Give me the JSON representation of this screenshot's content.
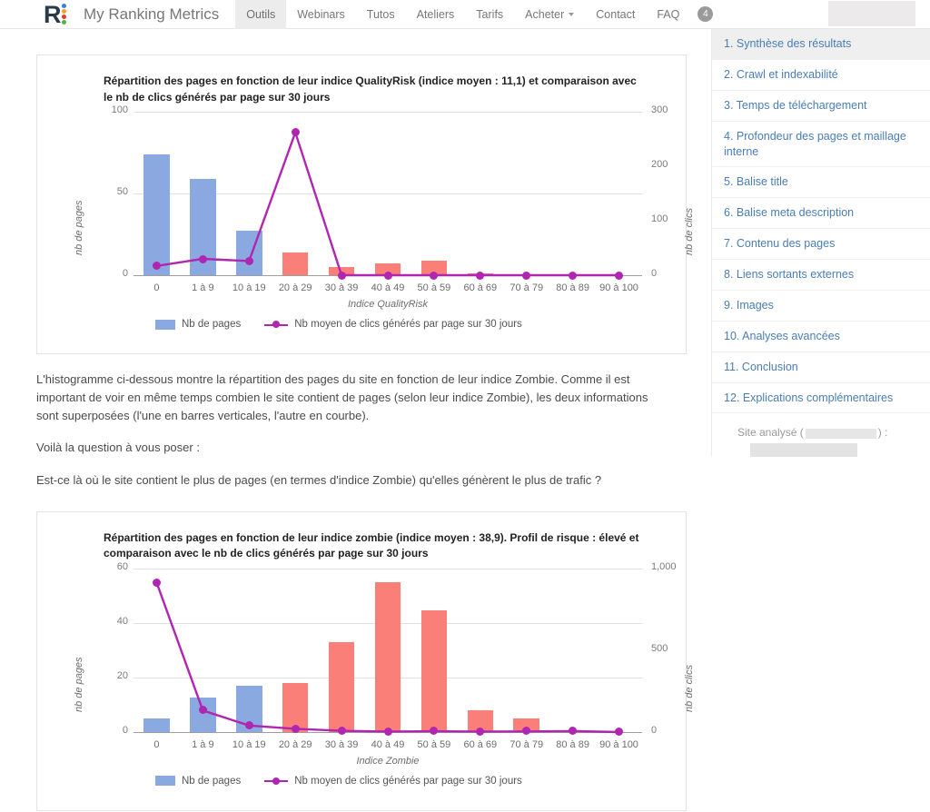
{
  "navbar": {
    "brand": "My Ranking Metrics",
    "logo_letter": "R",
    "links": [
      {
        "label": "Outils",
        "active": true
      },
      {
        "label": "Webinars",
        "active": false
      },
      {
        "label": "Tutos",
        "active": false
      },
      {
        "label": "Ateliers",
        "active": false
      },
      {
        "label": "Tarifs",
        "active": false
      },
      {
        "label": "Acheter",
        "active": false,
        "has_caret": true
      },
      {
        "label": "Contact",
        "active": false
      },
      {
        "label": "FAQ",
        "active": false
      }
    ],
    "badge": "4"
  },
  "sidebar": {
    "items": [
      "1. Synthèse des résultats",
      "2. Crawl et indexabilité",
      "3. Temps de téléchargement",
      "4. Profondeur des pages et maillage interne",
      "5. Balise title",
      "6. Balise meta description",
      "7. Contenu des pages",
      "8. Liens sortants externes",
      "9. Images",
      "10. Analyses avancées",
      "11. Conclusion",
      "12. Explications complémentaires"
    ],
    "note_prefix": "Site analysé (",
    "note_suffix": ") :"
  },
  "body_text": {
    "p1": "L'histogramme ci-dessous montre la répartition des pages du site en fonction de leur indice Zombie. Comme il est important de voir en même temps combien le site contient de pages (selon leur indice Zombie), les deux informations sont superposées (l'une en barres verticales, l'autre en courbe).",
    "p2": "Voilà la question à vous poser :",
    "p3": "Est-ce là où le site contient le plus de pages (en termes d'indice Zombie) qu'elles génèrent le plus de trafic ?"
  },
  "colors": {
    "bar_blue": "#8aa9e0",
    "bar_red": "#fb7f79",
    "line_purple": "#b026b0",
    "link_blue": "#4a7db5"
  },
  "chart_data": [
    {
      "type": "bar",
      "id": "qualityrisk",
      "title": "Répartition des pages en fonction de leur indice QualityRisk (indice moyen : 11,1) et comparaison avec le nb de clics générés par page sur 30 jours",
      "xlabel": "Indice QualityRisk",
      "ylabel": "nb de pages",
      "y2label": "nb de clics",
      "categories": [
        "0",
        "1 à 9",
        "10 à 19",
        "20 à 29",
        "30 à 39",
        "40 à 49",
        "50 à 59",
        "60 à 69",
        "70 à 79",
        "80 à 89",
        "90 à 100"
      ],
      "ylim": [
        0,
        100
      ],
      "yticks": [
        0,
        50,
        100
      ],
      "y2lim": [
        0,
        300
      ],
      "y2ticks": [
        0,
        100,
        200,
        300
      ],
      "grid": true,
      "legend_position": "bottom",
      "series": [
        {
          "name": "Nb de pages",
          "type": "bar",
          "axis": "left",
          "values": [
            74,
            59,
            27,
            14,
            5,
            7,
            9,
            1,
            0,
            0,
            0
          ],
          "bar_colors": [
            "blue",
            "blue",
            "blue",
            "red",
            "red",
            "red",
            "red",
            "red",
            "red",
            "red",
            "red"
          ]
        },
        {
          "name": "Nb moyen de clics générés par page sur 30 jours",
          "type": "line",
          "axis": "right",
          "values": [
            17,
            30,
            26,
            262,
            0,
            0,
            0,
            0,
            0,
            0,
            0
          ]
        }
      ]
    },
    {
      "type": "bar",
      "id": "zombie",
      "title": "Répartition des pages en fonction de leur indice zombie (indice moyen : 38,9). Profil de risque : élevé et comparaison avec le nb de clics générés par page sur 30 jours",
      "xlabel": "Indice Zombie",
      "ylabel": "nb de pages",
      "y2label": "nb de clics",
      "categories": [
        "0",
        "1 à 9",
        "10 à 19",
        "20 à 29",
        "30 à 39",
        "40 à 49",
        "50 à 59",
        "60 à 69",
        "70 à 79",
        "80 à 89",
        "90 à 100"
      ],
      "ylim": [
        0,
        60
      ],
      "yticks": [
        0,
        20,
        40,
        60
      ],
      "y2lim": [
        0,
        1000
      ],
      "y2ticks": [
        0,
        500,
        1000
      ],
      "y2ticklabels": [
        "0",
        "500",
        "1,000"
      ],
      "grid": true,
      "legend_position": "bottom",
      "series": [
        {
          "name": "Nb de pages",
          "type": "bar",
          "axis": "left",
          "values": [
            5,
            12.5,
            17,
            18,
            33,
            55,
            44.5,
            8,
            5,
            0.7,
            0
          ],
          "bar_colors": [
            "blue",
            "blue",
            "blue",
            "red",
            "red",
            "red",
            "red",
            "red",
            "red",
            "red",
            "red"
          ]
        },
        {
          "name": "Nb moyen de clics générés par page sur 30 jours",
          "type": "line",
          "axis": "right",
          "values": [
            915,
            132,
            40,
            20,
            8,
            3,
            5,
            3,
            4,
            6,
            0
          ]
        }
      ]
    }
  ]
}
